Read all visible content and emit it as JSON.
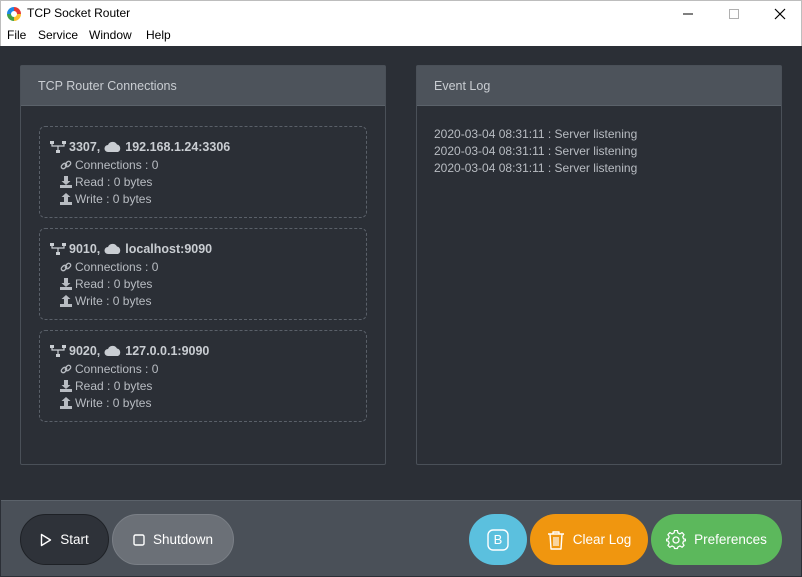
{
  "window": {
    "title": "TCP Socket Router"
  },
  "menu": [
    "File",
    "Service",
    "Window",
    "Help"
  ],
  "connections_panel": {
    "title": "TCP Router Connections",
    "items": [
      {
        "port": "3307,",
        "target": "192.168.1.24:3306",
        "connections": "Connections : 0",
        "read": "Read : 0 bytes",
        "write": "Write : 0 bytes"
      },
      {
        "port": "9010,",
        "target": "localhost:9090",
        "connections": "Connections : 0",
        "read": "Read : 0 bytes",
        "write": "Write : 0 bytes"
      },
      {
        "port": "9020,",
        "target": "127.0.0.1:9090",
        "connections": "Connections : 0",
        "read": "Read : 0 bytes",
        "write": "Write : 0 bytes"
      }
    ]
  },
  "event_log": {
    "title": "Event Log",
    "entries": [
      "2020-03-04 08:31:11 : Server listening",
      "2020-03-04 08:31:11 : Server listening",
      "2020-03-04 08:31:11 : Server listening"
    ]
  },
  "toolbar": {
    "start_label": "Start",
    "shutdown_label": "Shutdown",
    "b_label": "B",
    "clear_log_label": "Clear Log",
    "preferences_label": "Preferences"
  },
  "colors": {
    "background": "#2b2f36",
    "panel_header": "#4d535b",
    "info_button": "#5bc0de",
    "warning_button": "#f0960f",
    "success_button": "#5cb85c"
  },
  "icons": {
    "port": "sitemap-icon",
    "host": "cloud-icon",
    "connections": "link-icon",
    "read": "download-icon",
    "write": "upload-icon"
  }
}
